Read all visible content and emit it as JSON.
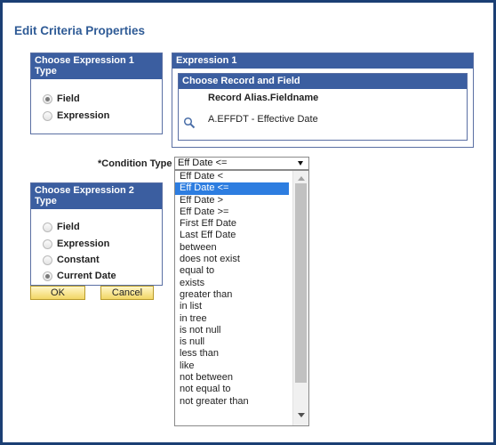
{
  "dialog": {
    "title": "Edit Criteria Properties"
  },
  "expr1_type": {
    "header": "Choose Expression 1 Type",
    "options": [
      {
        "label": "Field",
        "selected": true
      },
      {
        "label": "Expression",
        "selected": false
      }
    ]
  },
  "expression1": {
    "header": "Expression 1",
    "record_field_header": "Choose Record and Field",
    "column_label": "Record Alias.Fieldname",
    "value": "A.EFFDT - Effective Date",
    "lookup_icon": "magnifier-icon"
  },
  "condition": {
    "label": "*Condition Type",
    "selected": "Eff Date <=",
    "options": [
      "Eff Date <",
      "Eff Date <=",
      "Eff Date >",
      "Eff Date >=",
      "First Eff Date",
      "Last Eff Date",
      "between",
      "does not exist",
      "equal to",
      "exists",
      "greater than",
      "in list",
      "in tree",
      "is not null",
      "is null",
      "less than",
      "like",
      "not between",
      "not equal to",
      "not greater than"
    ]
  },
  "expr2_type": {
    "header": "Choose Expression 2 Type",
    "options": [
      {
        "label": "Field",
        "selected": false
      },
      {
        "label": "Expression",
        "selected": false
      },
      {
        "label": "Constant",
        "selected": false
      },
      {
        "label": "Current Date",
        "selected": true
      }
    ]
  },
  "buttons": {
    "ok": "OK",
    "cancel": "Cancel"
  },
  "colors": {
    "frame": "#1b3f74",
    "header_bg": "#3b5ea0",
    "title": "#2f5b96",
    "selection": "#2d7de0",
    "button": "#f2d665"
  }
}
